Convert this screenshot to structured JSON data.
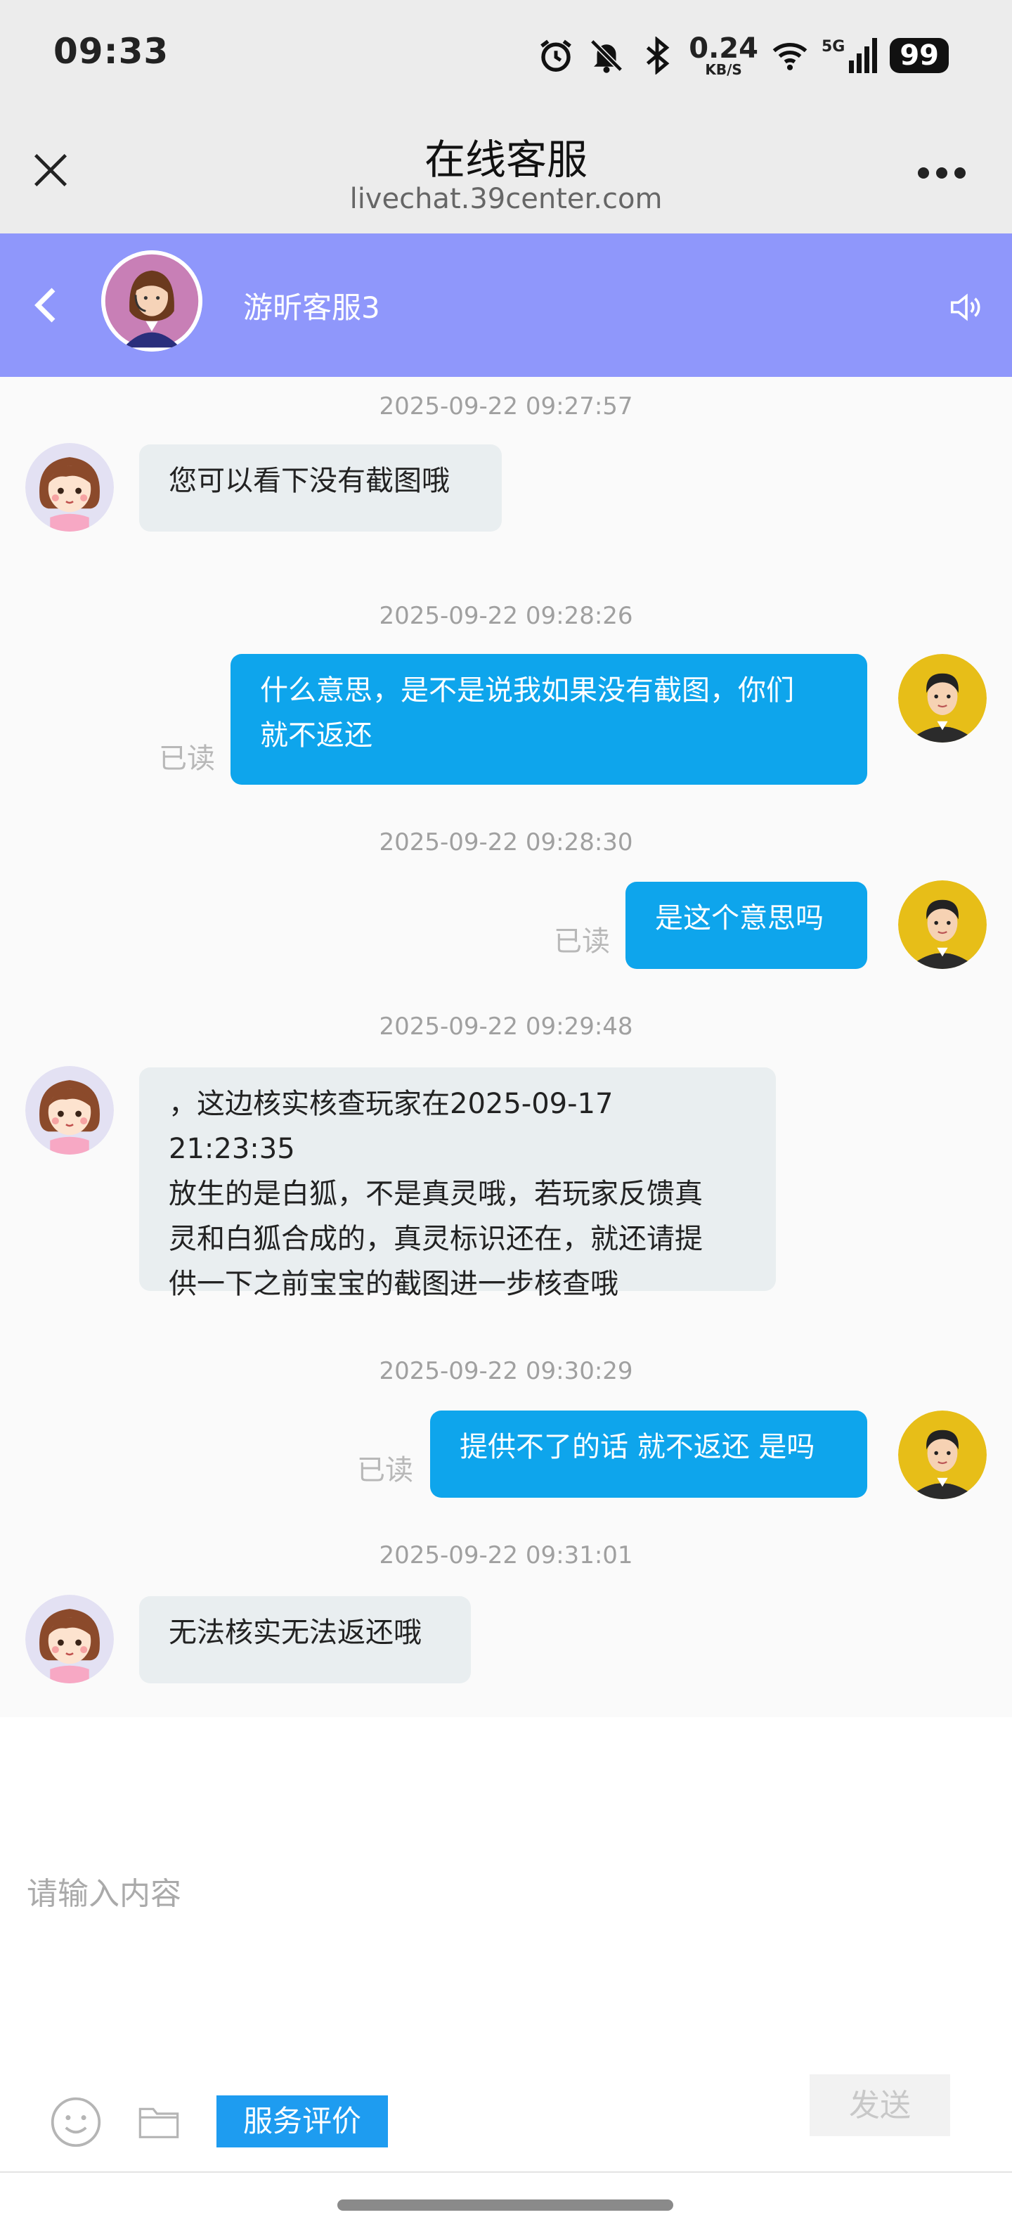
{
  "status_bar": {
    "time": "09:33",
    "net_speed": "0.24",
    "net_speed_unit": "KB/S",
    "signal_label": "5G",
    "battery": "99"
  },
  "browser": {
    "title": "在线客服",
    "url": "livechat.39center.com"
  },
  "chat_header": {
    "agent_name": "游昕客服3"
  },
  "messages": [
    {
      "time": "2025-09-22 09:27:57",
      "side": "left",
      "text": "您可以看下没有截图哦"
    },
    {
      "time": "2025-09-22 09:28:26",
      "side": "right",
      "line1": "什么意思，是不是说我如果没有截图，你们",
      "line2": "就不返还",
      "read": "已读"
    },
    {
      "time": "2025-09-22 09:28:30",
      "side": "right",
      "text": "是这个意思吗",
      "read": "已读"
    },
    {
      "time": "2025-09-22 09:29:48",
      "side": "left",
      "line1": "，这边核实核查玩家在2025-09-17 21:23:35",
      "line2": "放生的是白狐，不是真灵哦，若玩家反馈真",
      "line3": "灵和白狐合成的，真灵标识还在，就还请提",
      "line4": "供一下之前宝宝的截图进一步核查哦"
    },
    {
      "time": "2025-09-22 09:30:29",
      "side": "right",
      "text": "提供不了的话 就不返还 是吗",
      "read": "已读"
    },
    {
      "time": "2025-09-22 09:31:01",
      "side": "left",
      "text": "无法核实无法返还哦"
    }
  ],
  "input": {
    "placeholder": "请输入内容",
    "send_label": "发送",
    "rate_label": "服务评价"
  },
  "colors": {
    "header_purple": "#8f97fb",
    "user_bubble": "#0ea5ec",
    "agent_bubble": "#e9eef0",
    "rate_button": "#1e9cf0"
  }
}
